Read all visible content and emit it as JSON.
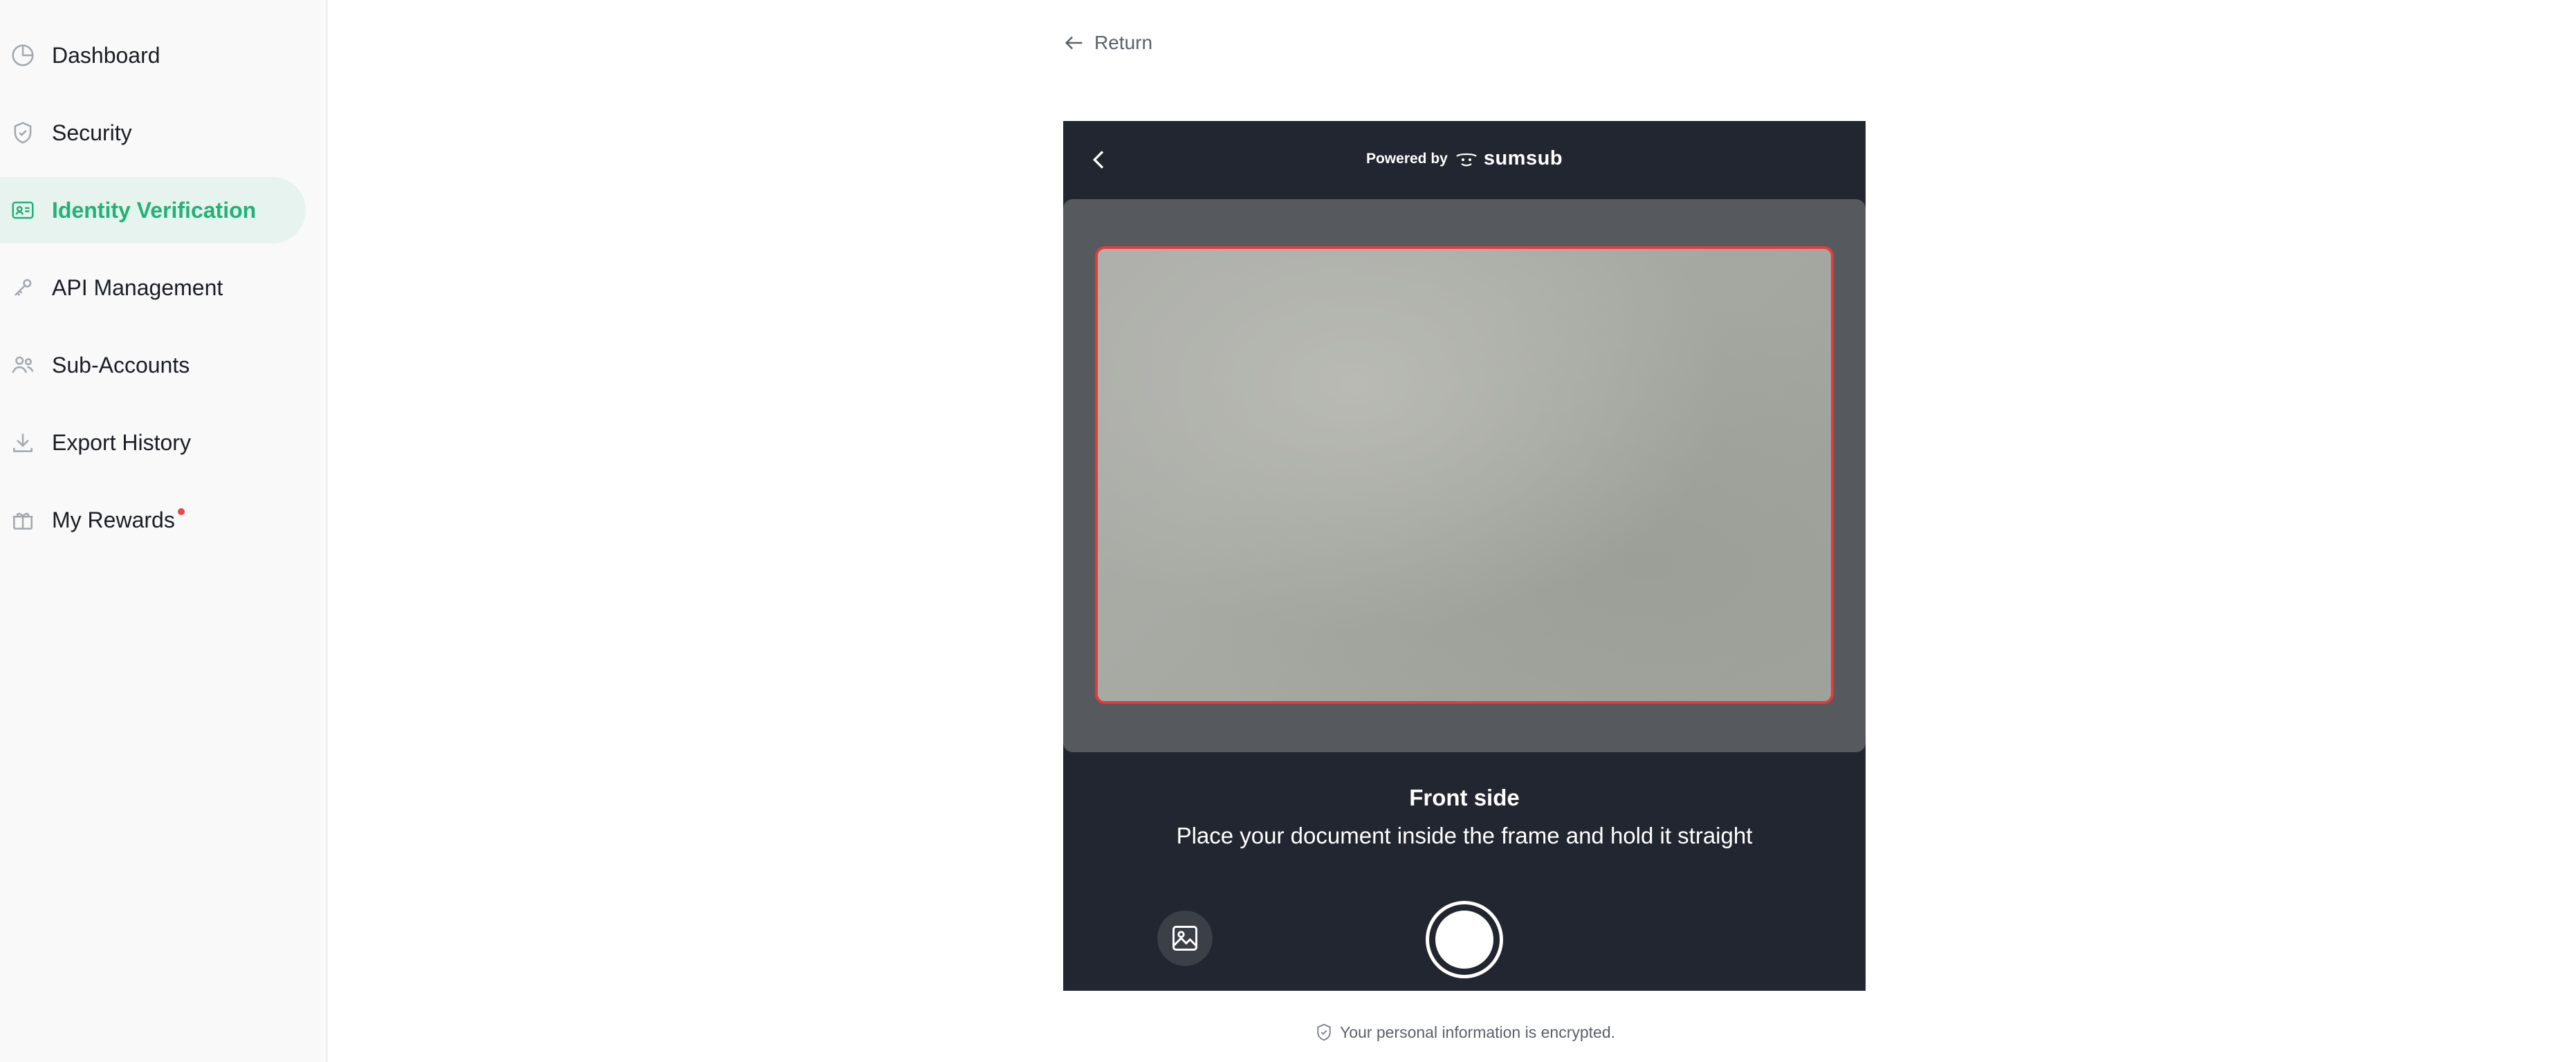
{
  "sidebar": {
    "items": [
      {
        "label": "Dashboard",
        "icon": "dashboard-icon",
        "active": false
      },
      {
        "label": "Security",
        "icon": "shield-icon",
        "active": false
      },
      {
        "label": "Identity Verification",
        "icon": "id-card-icon",
        "active": true
      },
      {
        "label": "API Management",
        "icon": "api-key-icon",
        "active": false
      },
      {
        "label": "Sub-Accounts",
        "icon": "users-icon",
        "active": false
      },
      {
        "label": "Export History",
        "icon": "download-icon",
        "active": false
      },
      {
        "label": "My Rewards",
        "icon": "gift-icon",
        "active": false,
        "has_notification_dot": true
      }
    ]
  },
  "main": {
    "return_label": "Return"
  },
  "sdk": {
    "powered_by": "Powered by",
    "brand": "sumsub",
    "instruction_title": "Front side",
    "instruction_text": "Place your document inside the frame and hold it straight"
  },
  "footer": {
    "encrypted_note": "Your personal information is encrypted."
  },
  "colors": {
    "accent": "#21b277",
    "active_bg": "#e6f3ee",
    "sdk_bg": "#212630",
    "frame_border": "#e33a3a",
    "notification_dot": "#e5484d"
  }
}
